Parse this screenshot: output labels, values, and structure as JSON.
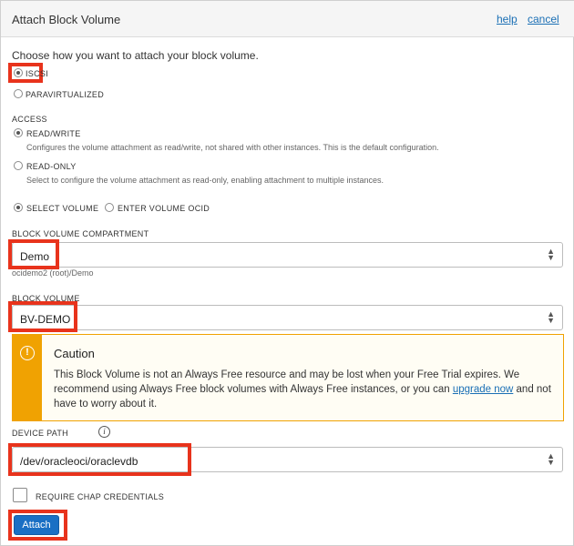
{
  "dialog": {
    "title": "Attach Block Volume",
    "help_label": "help",
    "cancel_label": "cancel"
  },
  "attachment_type": {
    "prompt": "Choose how you want to attach your block volume.",
    "options": [
      {
        "label": "ISCSI",
        "selected": true
      },
      {
        "label": "PARAVIRTUALIZED",
        "selected": false
      }
    ]
  },
  "access": {
    "heading": "ACCESS",
    "options": [
      {
        "label": "READ/WRITE",
        "selected": true,
        "description": "Configures the volume attachment as read/write, not shared with other instances. This is the default configuration."
      },
      {
        "label": "READ-ONLY",
        "selected": false,
        "description": "Select to configure the volume attachment as read-only, enabling attachment to multiple instances."
      }
    ]
  },
  "volume_selection": {
    "options": [
      {
        "label": "SELECT VOLUME",
        "selected": true
      },
      {
        "label": "ENTER VOLUME OCID",
        "selected": false
      }
    ]
  },
  "compartment": {
    "label": "BLOCK VOLUME COMPARTMENT",
    "value": "Demo",
    "path": "ocidemo2 (root)/Demo"
  },
  "block_volume": {
    "label": "BLOCK VOLUME",
    "value": "BV-DEMO"
  },
  "caution": {
    "title": "Caution",
    "text_before_link": "This Block Volume is not an Always Free resource and may be lost when your Free Trial expires. We recommend using Always Free block volumes with Always Free instances, or you can ",
    "link_text": "upgrade now",
    "text_after_link": " and not have to worry about it."
  },
  "device_path": {
    "label": "DEVICE PATH",
    "value": "/dev/oracleoci/oraclevdb"
  },
  "chap": {
    "label": "REQUIRE CHAP CREDENTIALS",
    "checked": false
  },
  "actions": {
    "attach_label": "Attach"
  },
  "colors": {
    "highlight": "#e8331c",
    "primary_button": "#1a6fc4",
    "caution_accent": "#f0a202",
    "link": "#1a6fb5"
  },
  "icons": [
    "radio-icon",
    "chevron-updown-icon",
    "warning-icon",
    "info-icon",
    "checkbox-icon"
  ]
}
